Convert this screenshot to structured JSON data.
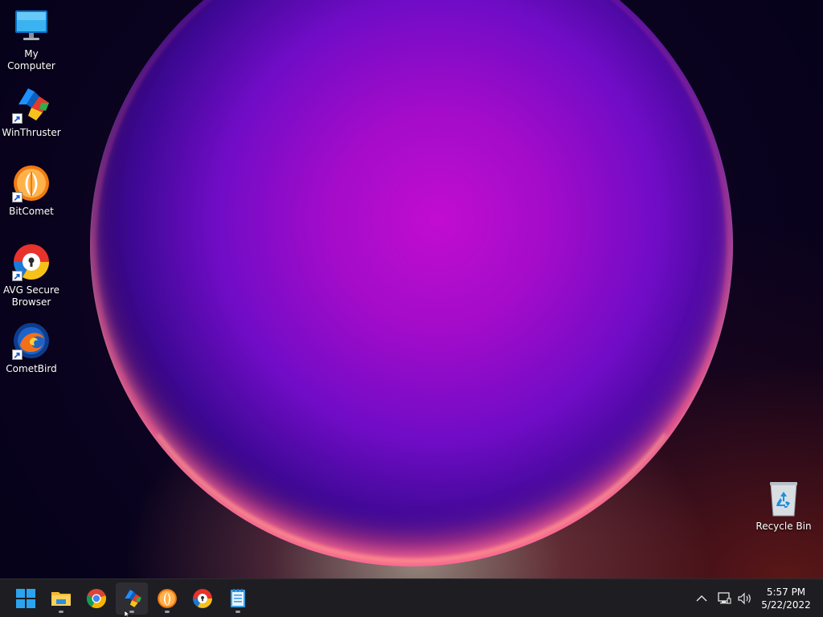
{
  "desktop": {
    "icons": [
      {
        "label": "My Computer",
        "icon": "monitor-icon"
      },
      {
        "label": "WinThruster",
        "icon": "winthruster-icon"
      },
      {
        "label": "BitComet",
        "icon": "bitcomet-icon"
      },
      {
        "label": "AVG Secure Browser",
        "icon": "avg-browser-icon"
      },
      {
        "label": "CometBird",
        "icon": "cometbird-icon"
      },
      {
        "label": "Recycle Bin",
        "icon": "recycle-bin-icon"
      }
    ]
  },
  "taskbar": {
    "apps": [
      {
        "name": "Start",
        "icon": "windows-logo-icon",
        "running": false,
        "active": false
      },
      {
        "name": "File Explorer",
        "icon": "folder-icon",
        "running": true,
        "active": false
      },
      {
        "name": "Chrome",
        "icon": "chrome-icon",
        "running": false,
        "active": false
      },
      {
        "name": "WinThruster",
        "icon": "winthruster-icon",
        "running": true,
        "active": true
      },
      {
        "name": "BitComet",
        "icon": "bitcomet-icon",
        "running": true,
        "active": false
      },
      {
        "name": "AVG Secure Browser",
        "icon": "avg-browser-icon",
        "running": false,
        "active": false
      },
      {
        "name": "Notepad",
        "icon": "notepad-icon",
        "running": true,
        "active": false
      }
    ],
    "tray": {
      "icons": [
        "chevron-up-icon",
        "network-icon",
        "volume-icon"
      ],
      "time": "5:57 PM",
      "date": "5/22/2022"
    }
  },
  "colors": {
    "taskbar_bg": "#1e1e22",
    "wallpaper_orb": "#b612c4",
    "wallpaper_bg": "#0a0320"
  }
}
